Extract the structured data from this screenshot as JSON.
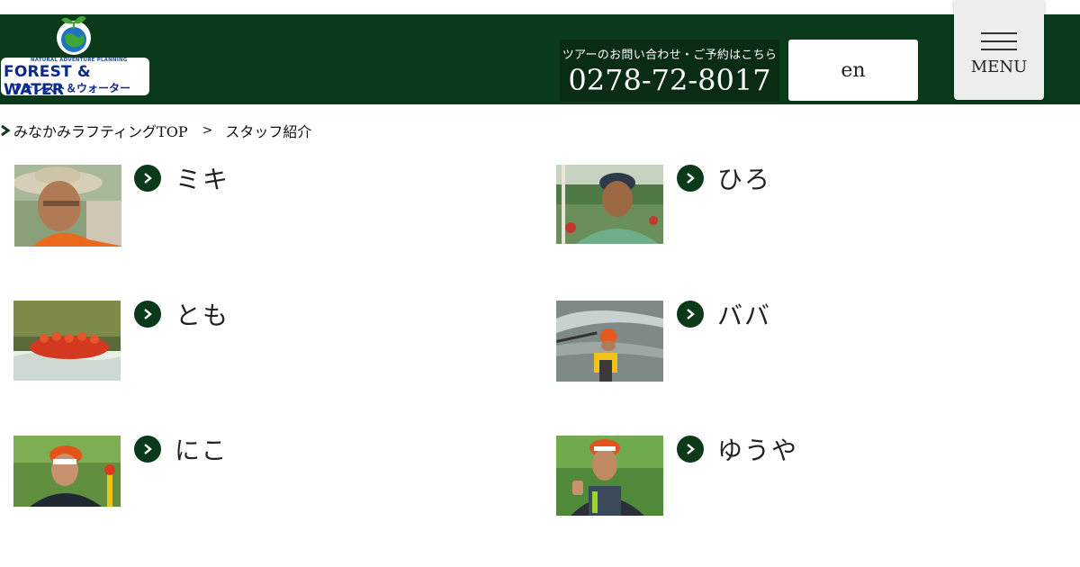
{
  "header": {
    "logo": {
      "line1": "NATURAL ADVENTURE PLANNING",
      "line2": "FOREST & WATER",
      "line3": "フォレスト＆ウォーター"
    },
    "contact_note": "ツアーのお問い合わせ・ご予約はこちら",
    "phone": "0278-72-8017",
    "lang_label": "en",
    "menu_label": "MENU"
  },
  "breadcrumb": {
    "home": "みなかみラフティングTOP",
    "separator": ">",
    "current": "スタッフ紹介"
  },
  "staff": [
    {
      "name": "ミキ",
      "photo": "man-in-wide-brim-hat-selfie"
    },
    {
      "name": "ひろ",
      "photo": "man-in-helmet-holding-paddle"
    },
    {
      "name": "とも",
      "photo": "rafting-boat-in-rapids"
    },
    {
      "name": "ババ",
      "photo": "kayaker-in-river-rapids"
    },
    {
      "name": "にこ",
      "photo": "woman-in-orange-helmet"
    },
    {
      "name": "ゆうや",
      "photo": "man-in-helmet-thumbs-up"
    }
  ],
  "colors": {
    "header_bg": "#0b3a1b",
    "contact_bg": "#0a2b14",
    "accent": "#0b3a1b"
  }
}
